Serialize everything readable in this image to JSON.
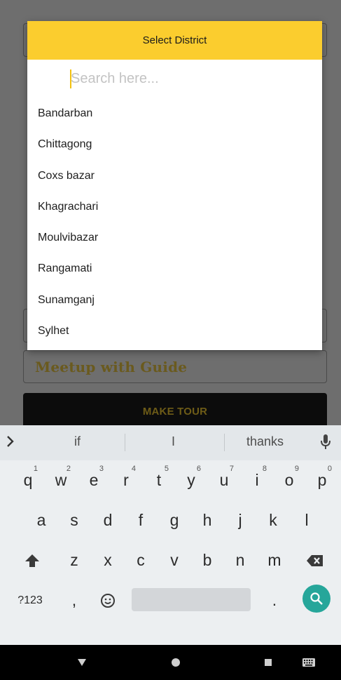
{
  "background": {
    "meetup_label": "Meetup with Guide",
    "make_tour_label": "MAKE TOUR"
  },
  "dialog": {
    "title": "Select District",
    "search_placeholder": "Search here...",
    "districts": [
      "Bandarban",
      "Chittagong",
      "Coxs bazar",
      "Khagrachari",
      "Moulvibazar",
      "Rangamati",
      "Sunamganj",
      "Sylhet"
    ]
  },
  "keyboard": {
    "suggestions": [
      "if",
      "I",
      "thanks"
    ],
    "row1": [
      {
        "k": "q",
        "h": "1"
      },
      {
        "k": "w",
        "h": "2"
      },
      {
        "k": "e",
        "h": "3"
      },
      {
        "k": "r",
        "h": "4"
      },
      {
        "k": "t",
        "h": "5"
      },
      {
        "k": "y",
        "h": "6"
      },
      {
        "k": "u",
        "h": "7"
      },
      {
        "k": "i",
        "h": "8"
      },
      {
        "k": "o",
        "h": "9"
      },
      {
        "k": "p",
        "h": "0"
      }
    ],
    "row2": [
      "a",
      "s",
      "d",
      "f",
      "g",
      "h",
      "j",
      "k",
      "l"
    ],
    "row3": [
      "z",
      "x",
      "c",
      "v",
      "b",
      "n",
      "m"
    ],
    "symbols_label": "?123",
    "comma": ",",
    "period": "."
  },
  "colors": {
    "accent_yellow": "#fbcd2e",
    "search_fab": "#26a69a"
  },
  "icons": {
    "suggest_expand": "chevron-right-icon",
    "mic": "mic-icon",
    "shift": "shift-icon",
    "backspace": "backspace-icon",
    "emoji": "emoji-icon",
    "search": "search-icon",
    "nav_back": "back-triangle-icon",
    "nav_home": "home-circle-icon",
    "nav_recents": "recents-square-icon",
    "nav_keyboard": "keyboard-icon"
  }
}
